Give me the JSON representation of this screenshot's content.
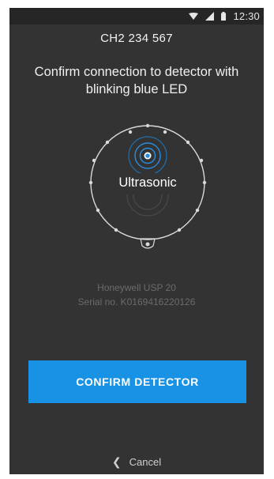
{
  "status_bar": {
    "time": "12:30",
    "icons": [
      "wifi-icon",
      "signal-icon",
      "battery-icon"
    ]
  },
  "header": {
    "device_id": "CH2 234 567"
  },
  "instruction": {
    "text": "Confirm connection to detector with blinking blue LED"
  },
  "detector": {
    "type_label": "Ultrasonic",
    "led_color": "#2a8de0"
  },
  "device_info": {
    "model": "Honeywell USP 20",
    "serial": "Serial no. K0169416220126"
  },
  "actions": {
    "confirm_label": "CONFIRM DETECTOR",
    "cancel_label": "Cancel"
  },
  "colors": {
    "background": "#333333",
    "status_bar": "#262626",
    "accent": "#1792e5",
    "muted_text": "#6b6b6b"
  }
}
